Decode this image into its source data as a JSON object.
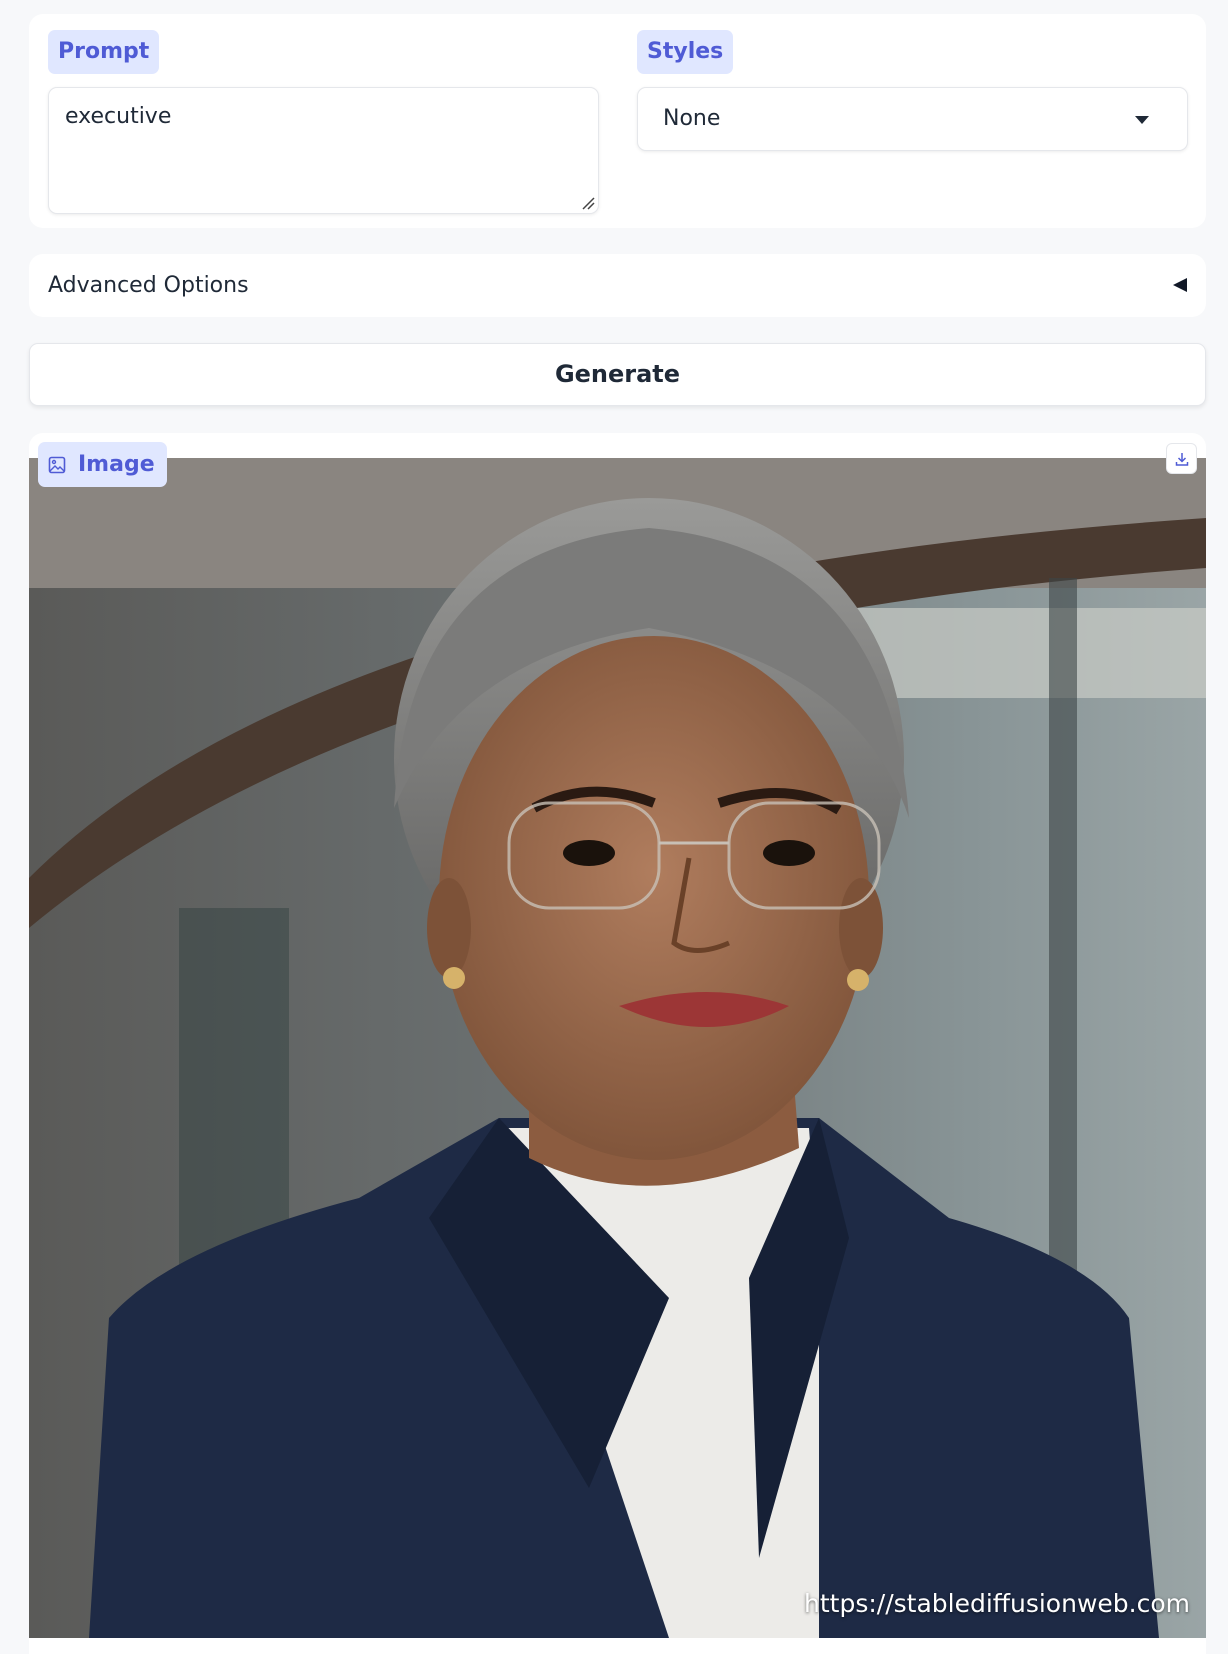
{
  "prompt": {
    "label": "Prompt",
    "value": "executive"
  },
  "styles": {
    "label": "Styles",
    "selected": "None"
  },
  "advanced": {
    "label": "Advanced Options"
  },
  "generate": {
    "label": "Generate"
  },
  "output": {
    "label": "Image",
    "watermark": "https://stablediffusionweb.com"
  },
  "colors": {
    "accent": "#4f5bd5",
    "chip_bg": "#e0e7ff",
    "background": "#f7f8fa"
  }
}
